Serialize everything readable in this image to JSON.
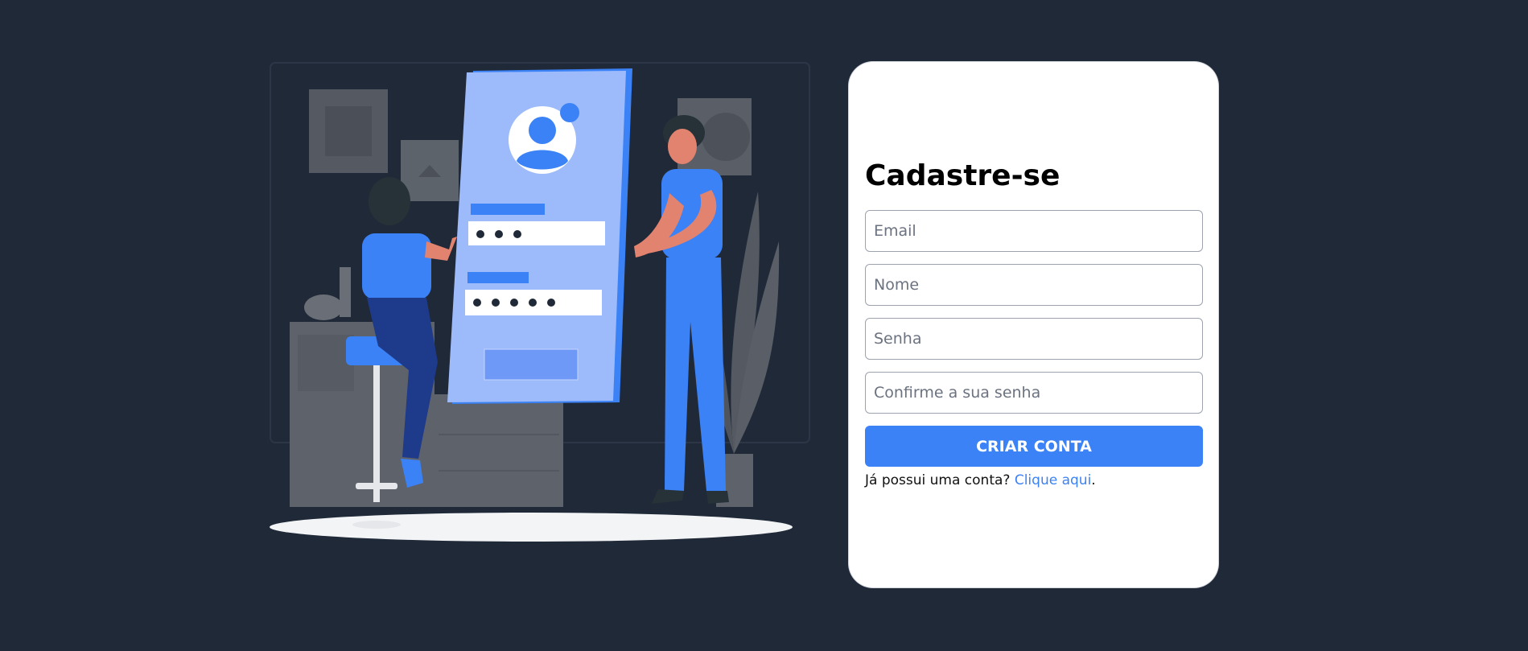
{
  "register": {
    "title": "Cadastre-se",
    "fields": [
      {
        "placeholder": "Email",
        "value": ""
      },
      {
        "placeholder": "Nome",
        "value": ""
      },
      {
        "placeholder": "Senha",
        "value": ""
      },
      {
        "placeholder": "Confirme a sua senha",
        "value": ""
      }
    ],
    "submit_label": "CRIAR CONTA",
    "login_prompt": "Já possui uma conta?",
    "login_link": "Clique aqui",
    "login_suffix": "."
  },
  "colors": {
    "background": "#202938",
    "card": "#ffffff",
    "accent": "#3b82f6"
  }
}
